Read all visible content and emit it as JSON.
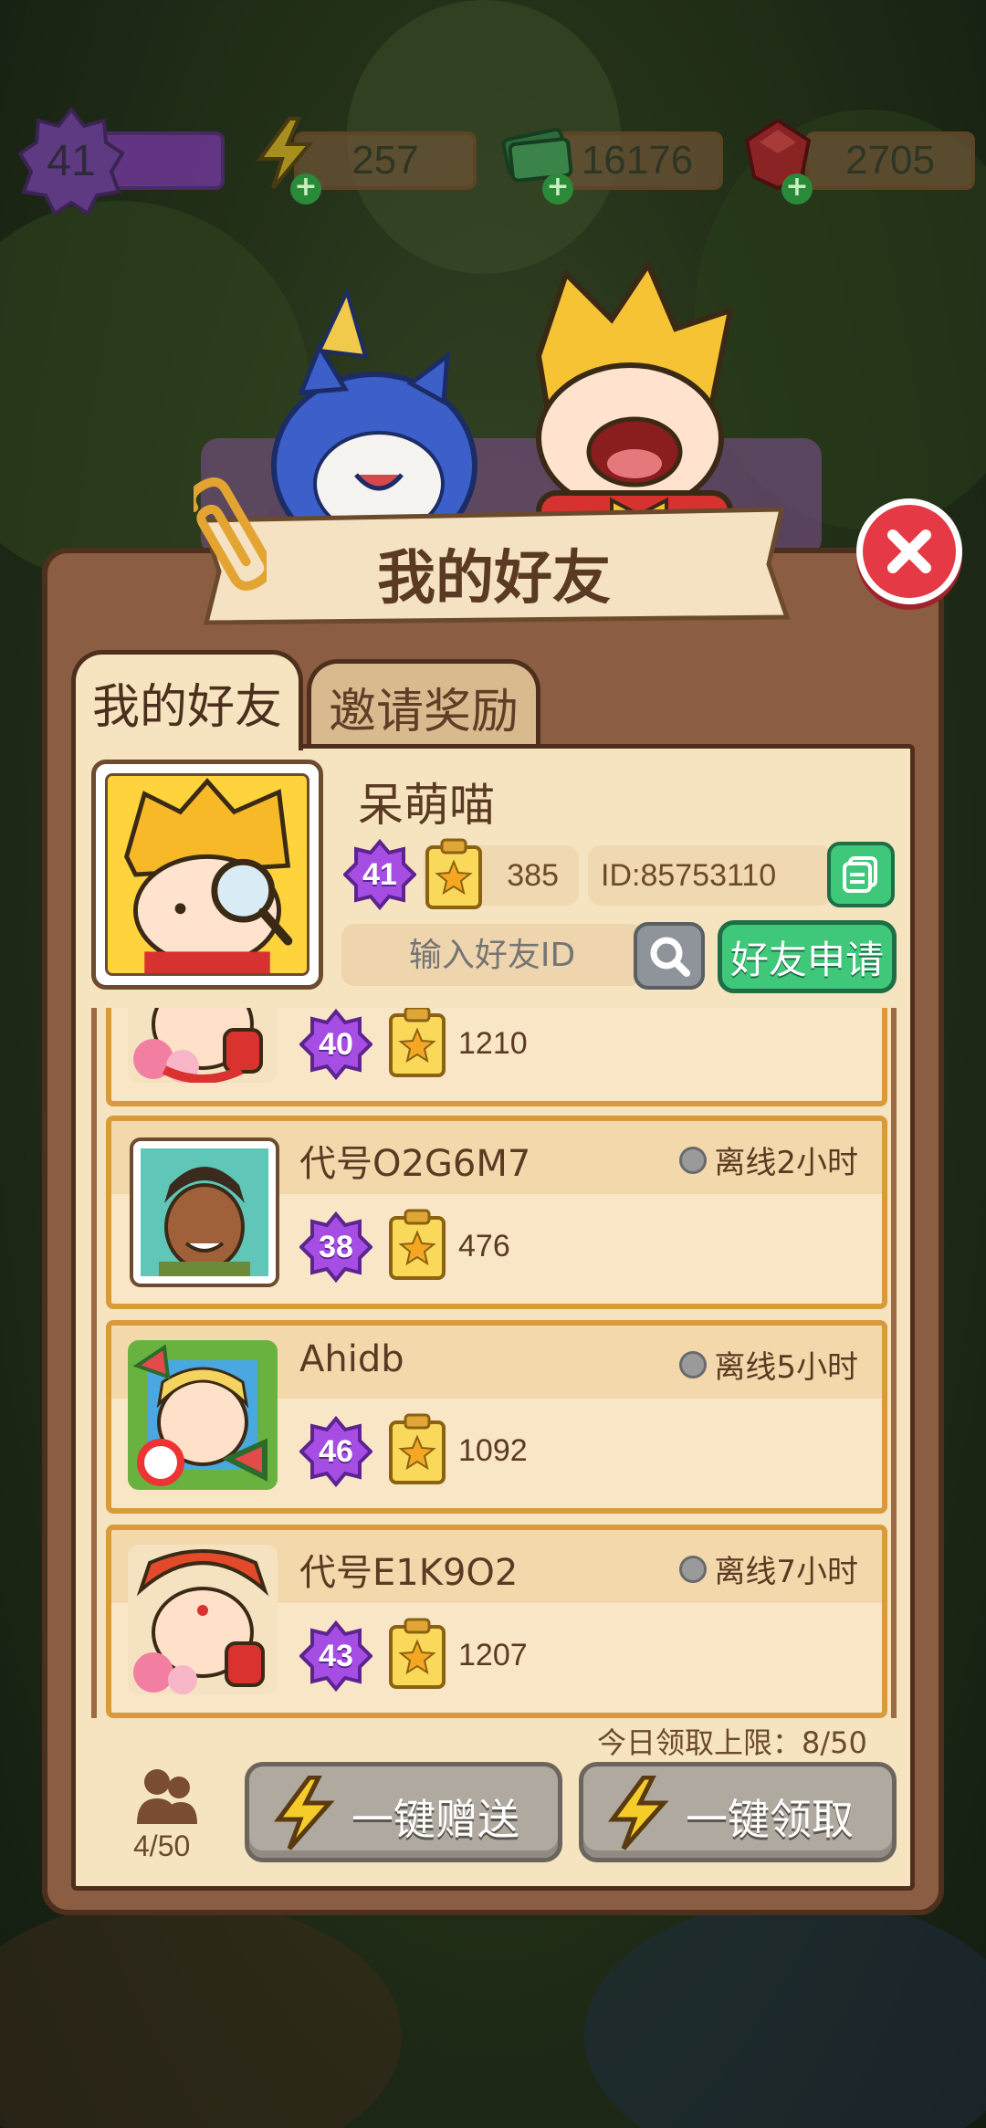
{
  "topbar": {
    "level": "41",
    "energy": "257",
    "cash": "16176",
    "gems": "2705"
  },
  "dialog": {
    "title": "我的好友"
  },
  "tabs": {
    "friends": "我的好友",
    "invite": "邀请奖励"
  },
  "profile": {
    "name": "呆萌喵",
    "level": "41",
    "score": "385",
    "id": "ID:85753110"
  },
  "search": {
    "placeholder": "输入好友ID",
    "apply_label": "好友申请"
  },
  "friends": [
    {
      "name": "",
      "status": "",
      "level": "40",
      "score": "1210"
    },
    {
      "name": "代号O2G6M7",
      "status": "离线2小时",
      "level": "38",
      "score": "476"
    },
    {
      "name": "Ahidb",
      "status": "离线5小时",
      "level": "46",
      "score": "1092"
    },
    {
      "name": "代号E1K9O2",
      "status": "离线7小时",
      "level": "43",
      "score": "1207"
    }
  ],
  "footer": {
    "daily_limit": "今日领取上限：8/50",
    "friend_count": "4/50",
    "send_all_label": "一键赠送",
    "claim_all_label": "一键领取"
  },
  "colors": {
    "panel": "#8b5e43",
    "parchment": "#f6e3bf",
    "accent_green": "#3fc77a",
    "close_red": "#e53a46",
    "level_purple": "#8b3fd1"
  }
}
